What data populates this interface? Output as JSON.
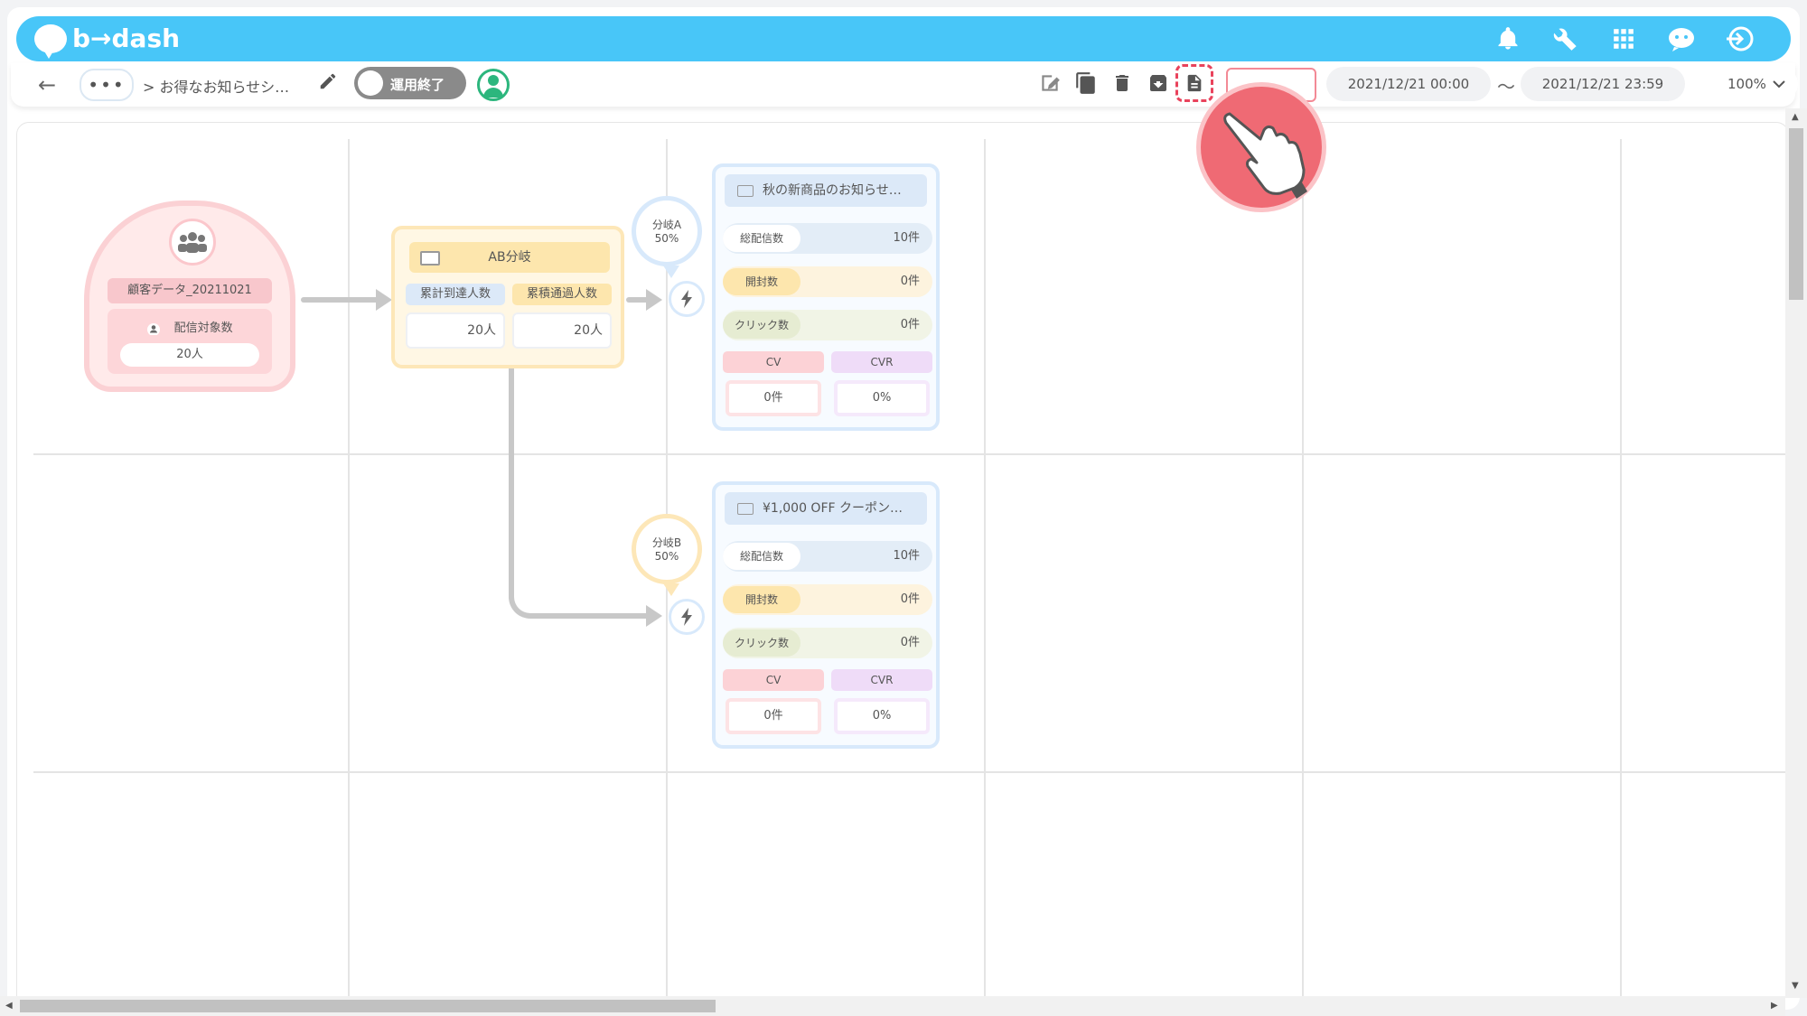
{
  "brand": {
    "name": "b→dash"
  },
  "topbar_icons": [
    "bell-icon",
    "wrench-icon",
    "grid-apps-icon",
    "chat-bot-icon",
    "logout-icon"
  ],
  "toolbar": {
    "breadcrumb_more": "•••",
    "breadcrumb": "> お得なお知らせシ…",
    "toggle_label": "運用終了",
    "start_date": "2021/12/21 00:00",
    "separator": "〜",
    "end_date": "2021/12/21 23:59",
    "zoom": "100%",
    "tool_icons": [
      "edit-icon",
      "copy-icon",
      "delete-icon",
      "archive-icon",
      "document-icon"
    ]
  },
  "flow": {
    "segment": {
      "title": "顧客データ_20211021",
      "label": "配信対象数",
      "value": "20人"
    },
    "ab_split": {
      "title": "AB分岐",
      "col1_label": "累計到達人数",
      "col2_label": "累積通過人数",
      "col1_value": "20人",
      "col2_value": "20人"
    },
    "branch_a": {
      "name": "分岐A",
      "ratio": "50%"
    },
    "branch_b": {
      "name": "分岐B",
      "ratio": "50%"
    },
    "mail_a": {
      "title": "秋の新商品のお知らせ…",
      "sent_label": "総配信数",
      "sent_value": "10件",
      "open_label": "開封数",
      "open_value": "0件",
      "click_label": "クリック数",
      "click_value": "0件",
      "cv_label": "CV",
      "cv_value": "0件",
      "cvr_label": "CVR",
      "cvr_value": "0%"
    },
    "mail_b": {
      "title": "¥1,000 OFF クーポン…",
      "sent_label": "総配信数",
      "sent_value": "10件",
      "open_label": "開封数",
      "open_value": "0件",
      "click_label": "クリック数",
      "click_value": "0件",
      "cv_label": "CV",
      "cv_value": "0件",
      "cvr_label": "CVR",
      "cvr_value": "0%"
    }
  },
  "colors": {
    "header": "#48c6f8",
    "segment": "#fbd1d4",
    "ab_split": "#fde7b8",
    "mail": "#d8e9fb",
    "highlight": "#e9435c"
  }
}
